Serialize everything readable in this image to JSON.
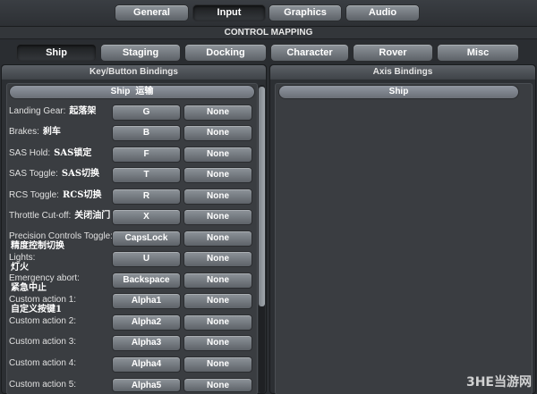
{
  "top_tabs": [
    "General",
    "Input",
    "Graphics",
    "Audio"
  ],
  "active_top_tab": "Input",
  "section_title": "CONTROL MAPPING",
  "category_tabs": [
    "Ship",
    "Staging",
    "Docking",
    "Character",
    "Rover",
    "Misc"
  ],
  "active_category_tab": "Ship",
  "left_panel": {
    "title": "Key/Button Bindings",
    "subheader": "Ship",
    "subheader_cn": "运输",
    "rows": [
      {
        "label": "Landing Gear:",
        "cn": "起落架",
        "primary": "G",
        "secondary": "None"
      },
      {
        "label": "Brakes:",
        "cn": "刹车",
        "primary": "B",
        "secondary": "None"
      },
      {
        "label": "SAS Hold:",
        "cn": "SAS锁定",
        "primary": "F",
        "secondary": "None"
      },
      {
        "label": "SAS Toggle:",
        "cn": "SAS切换",
        "primary": "T",
        "secondary": "None"
      },
      {
        "label": "RCS Toggle:",
        "cn": "RCS切换",
        "primary": "R",
        "secondary": "None"
      },
      {
        "label": "Throttle Cut-off:",
        "cn": "关闭油门",
        "primary": "X",
        "secondary": "None"
      },
      {
        "label": "Precision Controls Toggle:",
        "cn": "精度控制切换",
        "primary": "CapsLock",
        "secondary": "None"
      },
      {
        "label": "Lights:",
        "cn": "灯火",
        "primary": "U",
        "secondary": "None"
      },
      {
        "label": "Emergency abort:",
        "cn": "紧急中止",
        "primary": "Backspace",
        "secondary": "None"
      },
      {
        "label": "Custom action 1:",
        "cn": "自定义按键1",
        "primary": "Alpha1",
        "secondary": "None"
      },
      {
        "label": "Custom action 2:",
        "cn": "",
        "primary": "Alpha2",
        "secondary": "None"
      },
      {
        "label": "Custom action 3:",
        "cn": "",
        "primary": "Alpha3",
        "secondary": "None"
      },
      {
        "label": "Custom action 4:",
        "cn": "",
        "primary": "Alpha4",
        "secondary": "None"
      },
      {
        "label": "Custom action 5:",
        "cn": "",
        "primary": "Alpha5",
        "secondary": "None"
      }
    ]
  },
  "right_panel": {
    "title": "Axis Bindings",
    "subheader": "Ship"
  },
  "watermark": "3HE当游网"
}
